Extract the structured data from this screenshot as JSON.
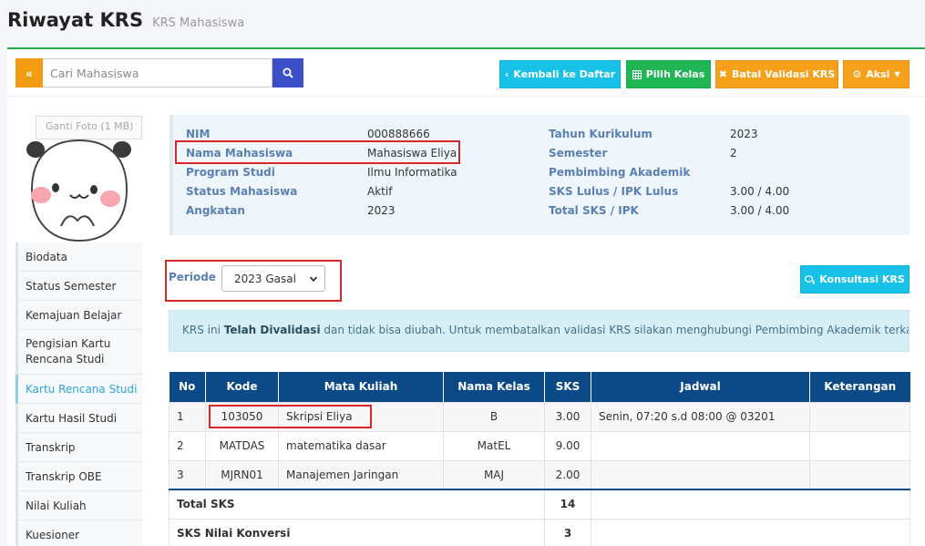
{
  "page": {
    "title": "Riwayat KRS",
    "subtitle": "KRS Mahasiswa"
  },
  "toolbar": {
    "search_placeholder": "Cari Mahasiswa",
    "kembali_label": "Kembali ke Daftar",
    "pilih_kelas_label": "Pilih Kelas",
    "batal_validasi_label": "Batal Validasi KRS",
    "aksi_label": "Aksi"
  },
  "photo": {
    "label": "Ganti Foto (1 MB)"
  },
  "sidebar": {
    "items": [
      {
        "label": "Biodata"
      },
      {
        "label": "Status Semester"
      },
      {
        "label": "Kemajuan Belajar"
      },
      {
        "label": "Pengisian Kartu Rencana Studi"
      },
      {
        "label": "Kartu Rencana Studi"
      },
      {
        "label": "Kartu Hasil Studi"
      },
      {
        "label": "Transkrip"
      },
      {
        "label": "Transkrip OBE"
      },
      {
        "label": "Nilai Kuliah"
      },
      {
        "label": "Kuesioner"
      }
    ]
  },
  "student": {
    "nim_label": "NIM",
    "nim": "000888666",
    "nama_label": "Nama Mahasiswa",
    "nama": "Mahasiswa Eliya",
    "prodi_label": "Program Studi",
    "prodi": "Ilmu Informatika",
    "status_label": "Status Mahasiswa",
    "status": "Aktif",
    "angkatan_label": "Angkatan",
    "angkatan": "2023",
    "kurikulum_label": "Tahun Kurikulum",
    "kurikulum": "2023",
    "semester_label": "Semester",
    "semester": "2",
    "pembimbing_label": "Pembimbing Akademik",
    "pembimbing": "",
    "sks_lulus_label": "SKS Lulus / IPK Lulus",
    "sks_lulus": "3.00 / 4.00",
    "total_sks_label": "Total SKS / IPK",
    "total_sks": "3.00 / 4.00"
  },
  "periode": {
    "label": "Periode",
    "selected": "2023 Gasal"
  },
  "konsultasi_label": "Konsultasi KRS",
  "alert": {
    "prefix": "KRS ini ",
    "bold": "Telah Divalidasi",
    "suffix": " dan tidak bisa diubah. Untuk membatalkan validasi KRS silakan menghubungi Pembimbing Akademik terkait"
  },
  "table": {
    "headers": {
      "no": "No",
      "kode": "Kode",
      "mk": "Mata Kuliah",
      "kelas": "Nama Kelas",
      "sks": "SKS",
      "jadwal": "Jadwal",
      "ket": "Keterangan"
    },
    "rows": [
      {
        "no": "1",
        "kode": "103050",
        "mk": "Skripsi Eliya",
        "kelas": "B",
        "sks": "3.00",
        "jadwal": "Senin, 07:20 s.d 08:00 @ 03201",
        "ket": ""
      },
      {
        "no": "2",
        "kode": "MATDAS",
        "mk": "matematika dasar",
        "kelas": "MatEL",
        "sks": "9.00",
        "jadwal": "",
        "ket": ""
      },
      {
        "no": "3",
        "kode": "MJRN01",
        "mk": "Manajemen Jaringan",
        "kelas": "MAJ",
        "sks": "2.00",
        "jadwal": "",
        "ket": ""
      }
    ],
    "total_sks_label": "Total SKS",
    "total_sks": "14",
    "konversi_label": "SKS Nilai Konversi",
    "konversi": "3"
  }
}
